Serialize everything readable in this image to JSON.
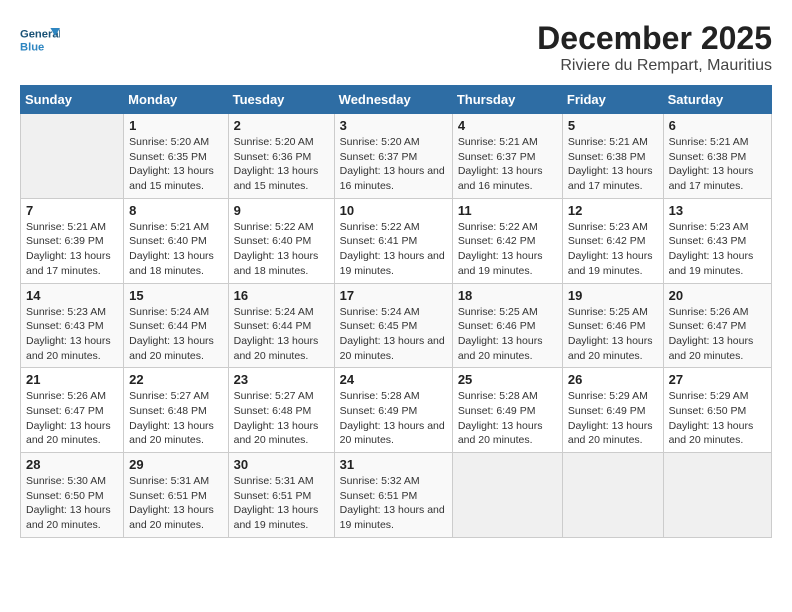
{
  "logo": {
    "line1": "General",
    "line2": "Blue"
  },
  "title": "December 2025",
  "subtitle": "Riviere du Rempart, Mauritius",
  "header_accent": "#2e6da4",
  "days_of_week": [
    "Sunday",
    "Monday",
    "Tuesday",
    "Wednesday",
    "Thursday",
    "Friday",
    "Saturday"
  ],
  "weeks": [
    [
      {
        "day": null,
        "info": null
      },
      {
        "day": "1",
        "sunrise": "Sunrise: 5:20 AM",
        "sunset": "Sunset: 6:35 PM",
        "daylight": "Daylight: 13 hours and 15 minutes."
      },
      {
        "day": "2",
        "sunrise": "Sunrise: 5:20 AM",
        "sunset": "Sunset: 6:36 PM",
        "daylight": "Daylight: 13 hours and 15 minutes."
      },
      {
        "day": "3",
        "sunrise": "Sunrise: 5:20 AM",
        "sunset": "Sunset: 6:37 PM",
        "daylight": "Daylight: 13 hours and 16 minutes."
      },
      {
        "day": "4",
        "sunrise": "Sunrise: 5:21 AM",
        "sunset": "Sunset: 6:37 PM",
        "daylight": "Daylight: 13 hours and 16 minutes."
      },
      {
        "day": "5",
        "sunrise": "Sunrise: 5:21 AM",
        "sunset": "Sunset: 6:38 PM",
        "daylight": "Daylight: 13 hours and 17 minutes."
      },
      {
        "day": "6",
        "sunrise": "Sunrise: 5:21 AM",
        "sunset": "Sunset: 6:38 PM",
        "daylight": "Daylight: 13 hours and 17 minutes."
      }
    ],
    [
      {
        "day": "7",
        "sunrise": "Sunrise: 5:21 AM",
        "sunset": "Sunset: 6:39 PM",
        "daylight": "Daylight: 13 hours and 17 minutes."
      },
      {
        "day": "8",
        "sunrise": "Sunrise: 5:21 AM",
        "sunset": "Sunset: 6:40 PM",
        "daylight": "Daylight: 13 hours and 18 minutes."
      },
      {
        "day": "9",
        "sunrise": "Sunrise: 5:22 AM",
        "sunset": "Sunset: 6:40 PM",
        "daylight": "Daylight: 13 hours and 18 minutes."
      },
      {
        "day": "10",
        "sunrise": "Sunrise: 5:22 AM",
        "sunset": "Sunset: 6:41 PM",
        "daylight": "Daylight: 13 hours and 19 minutes."
      },
      {
        "day": "11",
        "sunrise": "Sunrise: 5:22 AM",
        "sunset": "Sunset: 6:42 PM",
        "daylight": "Daylight: 13 hours and 19 minutes."
      },
      {
        "day": "12",
        "sunrise": "Sunrise: 5:23 AM",
        "sunset": "Sunset: 6:42 PM",
        "daylight": "Daylight: 13 hours and 19 minutes."
      },
      {
        "day": "13",
        "sunrise": "Sunrise: 5:23 AM",
        "sunset": "Sunset: 6:43 PM",
        "daylight": "Daylight: 13 hours and 19 minutes."
      }
    ],
    [
      {
        "day": "14",
        "sunrise": "Sunrise: 5:23 AM",
        "sunset": "Sunset: 6:43 PM",
        "daylight": "Daylight: 13 hours and 20 minutes."
      },
      {
        "day": "15",
        "sunrise": "Sunrise: 5:24 AM",
        "sunset": "Sunset: 6:44 PM",
        "daylight": "Daylight: 13 hours and 20 minutes."
      },
      {
        "day": "16",
        "sunrise": "Sunrise: 5:24 AM",
        "sunset": "Sunset: 6:44 PM",
        "daylight": "Daylight: 13 hours and 20 minutes."
      },
      {
        "day": "17",
        "sunrise": "Sunrise: 5:24 AM",
        "sunset": "Sunset: 6:45 PM",
        "daylight": "Daylight: 13 hours and 20 minutes."
      },
      {
        "day": "18",
        "sunrise": "Sunrise: 5:25 AM",
        "sunset": "Sunset: 6:46 PM",
        "daylight": "Daylight: 13 hours and 20 minutes."
      },
      {
        "day": "19",
        "sunrise": "Sunrise: 5:25 AM",
        "sunset": "Sunset: 6:46 PM",
        "daylight": "Daylight: 13 hours and 20 minutes."
      },
      {
        "day": "20",
        "sunrise": "Sunrise: 5:26 AM",
        "sunset": "Sunset: 6:47 PM",
        "daylight": "Daylight: 13 hours and 20 minutes."
      }
    ],
    [
      {
        "day": "21",
        "sunrise": "Sunrise: 5:26 AM",
        "sunset": "Sunset: 6:47 PM",
        "daylight": "Daylight: 13 hours and 20 minutes."
      },
      {
        "day": "22",
        "sunrise": "Sunrise: 5:27 AM",
        "sunset": "Sunset: 6:48 PM",
        "daylight": "Daylight: 13 hours and 20 minutes."
      },
      {
        "day": "23",
        "sunrise": "Sunrise: 5:27 AM",
        "sunset": "Sunset: 6:48 PM",
        "daylight": "Daylight: 13 hours and 20 minutes."
      },
      {
        "day": "24",
        "sunrise": "Sunrise: 5:28 AM",
        "sunset": "Sunset: 6:49 PM",
        "daylight": "Daylight: 13 hours and 20 minutes."
      },
      {
        "day": "25",
        "sunrise": "Sunrise: 5:28 AM",
        "sunset": "Sunset: 6:49 PM",
        "daylight": "Daylight: 13 hours and 20 minutes."
      },
      {
        "day": "26",
        "sunrise": "Sunrise: 5:29 AM",
        "sunset": "Sunset: 6:49 PM",
        "daylight": "Daylight: 13 hours and 20 minutes."
      },
      {
        "day": "27",
        "sunrise": "Sunrise: 5:29 AM",
        "sunset": "Sunset: 6:50 PM",
        "daylight": "Daylight: 13 hours and 20 minutes."
      }
    ],
    [
      {
        "day": "28",
        "sunrise": "Sunrise: 5:30 AM",
        "sunset": "Sunset: 6:50 PM",
        "daylight": "Daylight: 13 hours and 20 minutes."
      },
      {
        "day": "29",
        "sunrise": "Sunrise: 5:31 AM",
        "sunset": "Sunset: 6:51 PM",
        "daylight": "Daylight: 13 hours and 20 minutes."
      },
      {
        "day": "30",
        "sunrise": "Sunrise: 5:31 AM",
        "sunset": "Sunset: 6:51 PM",
        "daylight": "Daylight: 13 hours and 19 minutes."
      },
      {
        "day": "31",
        "sunrise": "Sunrise: 5:32 AM",
        "sunset": "Sunset: 6:51 PM",
        "daylight": "Daylight: 13 hours and 19 minutes."
      },
      {
        "day": null,
        "info": null
      },
      {
        "day": null,
        "info": null
      },
      {
        "day": null,
        "info": null
      }
    ]
  ]
}
